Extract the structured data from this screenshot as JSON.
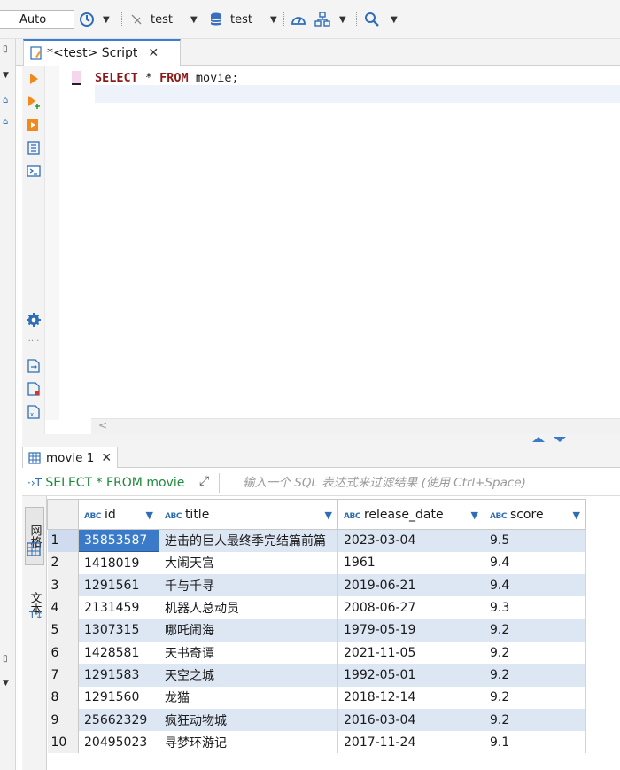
{
  "toolbar": {
    "auto_label": "Auto",
    "datasource_label": "test",
    "schema_label": "test",
    "icons": [
      "history-icon",
      "caret-icon",
      "datasource-icon",
      "database-icon",
      "dashboard-icon",
      "network-icon",
      "search-icon"
    ]
  },
  "editor": {
    "tab_label": "*<test> Script",
    "sql_keyword_select": "SELECT",
    "sql_star": " * ",
    "sql_keyword_from": "FROM",
    "sql_table": " movie;",
    "scroll_label": "<"
  },
  "results": {
    "tab_label": "movie 1",
    "query_label": "SELECT * FROM movie",
    "filter_placeholder": "输入一个 SQL 表达式来过滤结果 (使用 Ctrl+Space)",
    "side_tabs": {
      "grid": "网格",
      "text": "文本"
    },
    "columns": [
      {
        "type": "ABC",
        "name": "id"
      },
      {
        "type": "ABC",
        "name": "title"
      },
      {
        "type": "ABC",
        "name": "release_date"
      },
      {
        "type": "ABC",
        "name": "score"
      }
    ],
    "rows": [
      {
        "n": "1",
        "id": "35853587",
        "title": "进击的巨人最终季完结篇前篇",
        "date": "2023-03-04",
        "score": "9.5"
      },
      {
        "n": "2",
        "id": "1418019",
        "title": "大闹天宫",
        "date": "1961",
        "score": "9.4"
      },
      {
        "n": "3",
        "id": "1291561",
        "title": "千与千寻",
        "date": "2019-06-21",
        "score": "9.4"
      },
      {
        "n": "4",
        "id": "2131459",
        "title": "机器人总动员",
        "date": "2008-06-27",
        "score": "9.3"
      },
      {
        "n": "5",
        "id": "1307315",
        "title": "哪吒闹海",
        "date": "1979-05-19",
        "score": "9.2"
      },
      {
        "n": "6",
        "id": "1428581",
        "title": "天书奇谭",
        "date": "2021-11-05",
        "score": "9.2"
      },
      {
        "n": "7",
        "id": "1291583",
        "title": "天空之城",
        "date": "1992-05-01",
        "score": "9.2"
      },
      {
        "n": "8",
        "id": "1291560",
        "title": "龙猫",
        "date": "2018-12-14",
        "score": "9.2"
      },
      {
        "n": "9",
        "id": "25662329",
        "title": "疯狂动物城",
        "date": "2016-03-04",
        "score": "9.2"
      },
      {
        "n": "10",
        "id": "20495023",
        "title": "寻梦环游记",
        "date": "2017-11-24",
        "score": "9.1"
      }
    ]
  },
  "colors": {
    "accent": "#3c7fd0",
    "row_stripe": "#dde6f3",
    "keyword": "#8a1a1a",
    "query_green": "#1f8a3a"
  }
}
